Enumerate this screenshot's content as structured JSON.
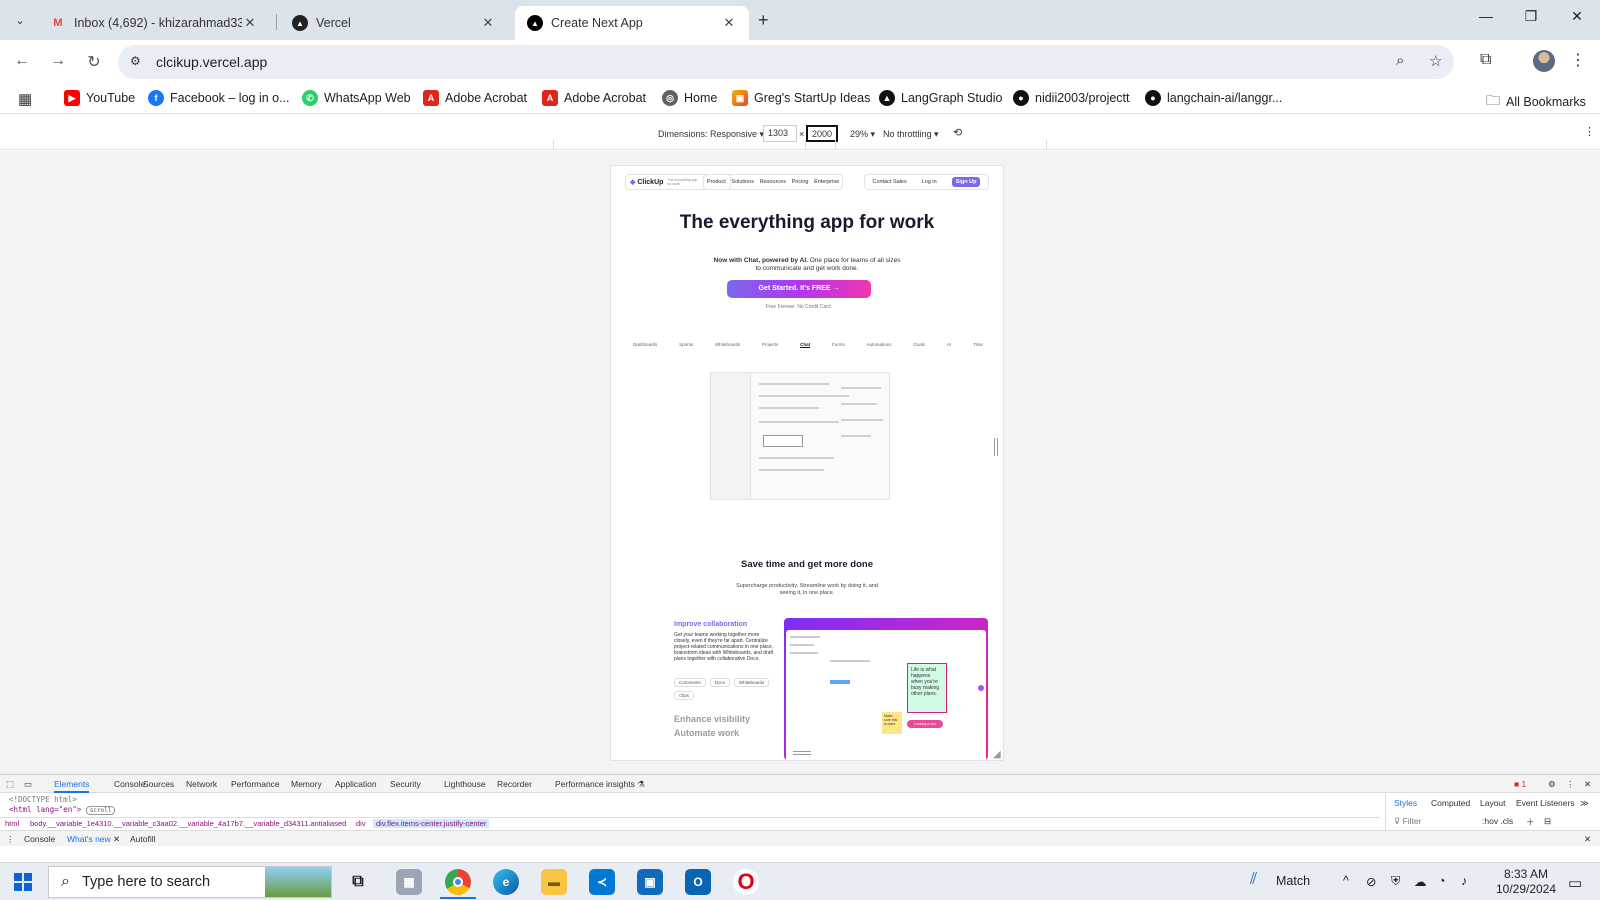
{
  "browser": {
    "tabs": [
      {
        "title": "Inbox (4,692) - khizarahmad333",
        "favicon": "gmail-icon",
        "active": false
      },
      {
        "title": "Vercel",
        "favicon": "vercel-icon",
        "active": false
      },
      {
        "title": "Create Next App",
        "favicon": "nextjs-icon",
        "active": true
      }
    ],
    "url": "clcikup.vercel.app"
  },
  "bookmarks": [
    {
      "label": "YouTube",
      "icon": "youtube-icon",
      "color": "#ff0000"
    },
    {
      "label": "Facebook – log in o...",
      "icon": "facebook-icon",
      "color": "#1877f2"
    },
    {
      "label": "WhatsApp Web",
      "icon": "whatsapp-icon",
      "color": "#25d366"
    },
    {
      "label": "Adobe Acrobat",
      "icon": "acrobat-icon",
      "color": "#e1251b"
    },
    {
      "label": "Adobe Acrobat",
      "icon": "acrobat-icon",
      "color": "#e1251b"
    },
    {
      "label": "Home",
      "icon": "globe-icon",
      "color": "#5f6368"
    },
    {
      "label": "Greg's StartUp Ideas",
      "icon": "startup-icon",
      "color": "#f4b400"
    },
    {
      "label": "LangGraph Studio",
      "icon": "langgraph-icon",
      "color": "#111111"
    },
    {
      "label": "nidii2003/projectt",
      "icon": "github-icon",
      "color": "#111111"
    },
    {
      "label": "langchain-ai/langgr...",
      "icon": "github-icon",
      "color": "#111111"
    }
  ],
  "all_bookmarks": "All Bookmarks",
  "device_toolbar": {
    "dimensions": "Dimensions: Responsive ▾",
    "width": "1303",
    "x": "×",
    "height": "2000",
    "zoom": "29% ▾",
    "throttling": "No throttling ▾"
  },
  "page": {
    "logo": "ClickUp",
    "logo_tagline": "The everything app for work",
    "nav_links": [
      "Product",
      "Solutions",
      "Resources",
      "Pricing",
      "Enterprise"
    ],
    "contact": "Contact Sales",
    "login": "Log in",
    "signup": "Sign Up",
    "hero_title": "The everything app for work",
    "hero_sub_bold": "Now with Chat, powered by AI.",
    "hero_sub": "One place for teams of all sizes to communicate and get work done.",
    "cta": "Get Started. It's FREE →",
    "cta_note": "Free Forever. No Credit Card.",
    "feature_tabs": [
      "Dashboards",
      "Sprints",
      "Whiteboards",
      "Projects",
      "Chat",
      "Forms",
      "Automations",
      "Goals",
      "AI",
      "Time"
    ],
    "active_feature": "Chat",
    "section2_title": "Save time and get more done",
    "section2_sub": "Supercharge productivity. Streamline work by doing it, and seeing it, in one place.",
    "collab_title": "Improve collaboration",
    "collab_text": "Get your teams working together more closely, even if they're far apart. Centralize project-related communications in one place, brainstorm ideas with Whiteboards, and draft plans together with collaborative Docs.",
    "chips": [
      "Comments",
      "Docs",
      "Whiteboards",
      "Clips"
    ],
    "enhance": "Enhance visibility",
    "automate": "Automate work",
    "sticky_text": "Life is what happens when you're busy making other plans.",
    "pill_text": "Looking a star",
    "sticky2_text": "Make sure this is done"
  },
  "devtools": {
    "tabs": [
      "Elements",
      "Console",
      "Sources",
      "Network",
      "Performance",
      "Memory",
      "Application",
      "Security",
      "Lighthouse",
      "Recorder",
      "Performance insights ⚗"
    ],
    "active_tab": "Elements",
    "code_line1": "<!DOCTYPE html>",
    "code_line2": "<html lang=\"en\">",
    "code_badge": "scroll",
    "crumbs": [
      "html",
      "body.__variable_1e4310.__variable_c3aa02.__variable_4a17b7.__variable_d34311.antialiased",
      "div",
      "div.flex.items-center.justify-center"
    ],
    "side_tabs": [
      "Styles",
      "Computed",
      "Layout",
      "Event Listeners",
      "≫"
    ],
    "filter": "Filter",
    "filter_tools": ":hov  .cls",
    "drawer_tabs": [
      "Console",
      "What's new",
      "Autofill"
    ],
    "error_count": "1"
  },
  "taskbar": {
    "search_placeholder": "Type here to search",
    "weather": "Match",
    "time": "8:33 AM",
    "date": "10/29/2024"
  }
}
